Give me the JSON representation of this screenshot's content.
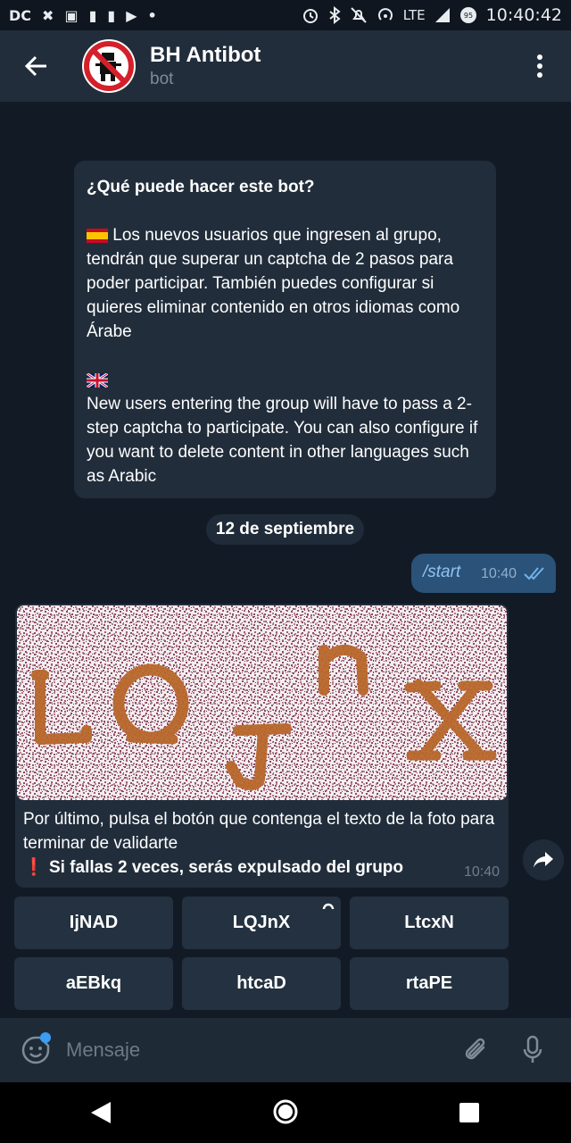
{
  "statusbar": {
    "left_icons": [
      "DC",
      "✖",
      "▣",
      "▮",
      "▮",
      "▶",
      "•"
    ],
    "network": "LTE",
    "time": "10:40:42"
  },
  "header": {
    "title": "BH Antibot",
    "subtitle": "bot"
  },
  "info_card": {
    "question": "¿Qué puede hacer este bot?",
    "spanish_text": "Los nuevos usuarios que ingresen al grupo, tendrán que superar un captcha de 2 pasos para poder participar. También puedes configurar si quieres eliminar contenido en otros idiomas como Árabe",
    "english_text": "New users entering the group will have to pass a 2-step captcha to participate. You can also configure if you want to delete content in other languages   such as Arabic"
  },
  "date_separator": "12 de septiembre",
  "outgoing_message": {
    "text": "/start",
    "time": "10:40"
  },
  "incoming_message": {
    "captcha_letters": [
      "L",
      "Q",
      "J",
      "n",
      "x"
    ],
    "text": "Por último, pulsa el botón que contenga el texto de la foto para terminar de validarte",
    "warning_icon": "❗",
    "warning": "Si fallas 2 veces, serás expulsado del grupo",
    "time": "10:40"
  },
  "keyboard": {
    "buttons": [
      "IjNAD",
      "LQJnX",
      "LtcxN",
      "aEBkq",
      "htcaD",
      "rtaPE"
    ]
  },
  "composer": {
    "placeholder": "Mensaje"
  },
  "colors": {
    "header_bg": "#212d3b",
    "chat_bg": "#121b25",
    "outgoing_bubble": "#2b5278",
    "incoming_bubble": "#212d3b",
    "captcha_noise": "#9a5a6e",
    "captcha_letters": "#b8672a"
  }
}
